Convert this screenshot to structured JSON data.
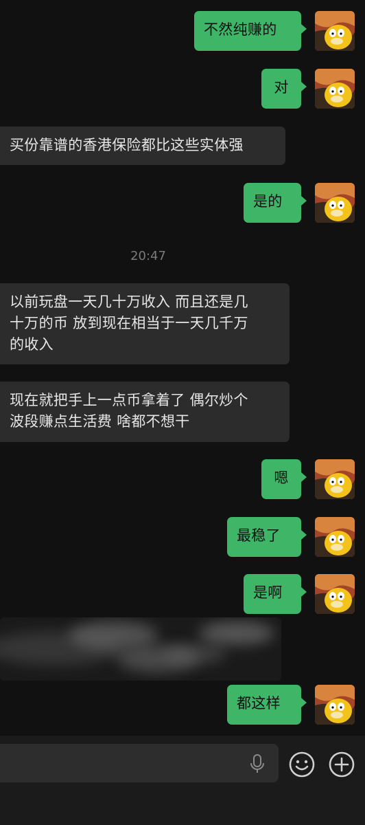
{
  "messages": [
    {
      "from": "me",
      "text": "不然纯赚的"
    },
    {
      "from": "me",
      "text": "对"
    },
    {
      "from": "them",
      "text": "买份靠谱的香港保险都比这些实体强"
    },
    {
      "from": "me",
      "text": "是的"
    },
    {
      "from": "system",
      "text": "20:47"
    },
    {
      "from": "them",
      "lines": [
        "以前玩盘一天几十万收入 而且还是几",
        "十万的币 放到现在相当于一天几千万",
        "的收入"
      ]
    },
    {
      "from": "them",
      "lines": [
        "现在就把手上一点币拿着了 偶尔炒个",
        "波段赚点生活费 啥都不想干"
      ]
    },
    {
      "from": "me",
      "text": "嗯"
    },
    {
      "from": "me",
      "text": "最稳了"
    },
    {
      "from": "me",
      "text": "是啊"
    },
    {
      "from": "them",
      "redacted": true
    },
    {
      "from": "me",
      "text": "都这样"
    }
  ],
  "colors": {
    "outgoing": "#3eb567",
    "incoming": "#2c2c2c",
    "background": "#111111"
  },
  "input_bar": {
    "icons": [
      "microphone-icon",
      "emoji-icon",
      "plus-icon"
    ]
  }
}
